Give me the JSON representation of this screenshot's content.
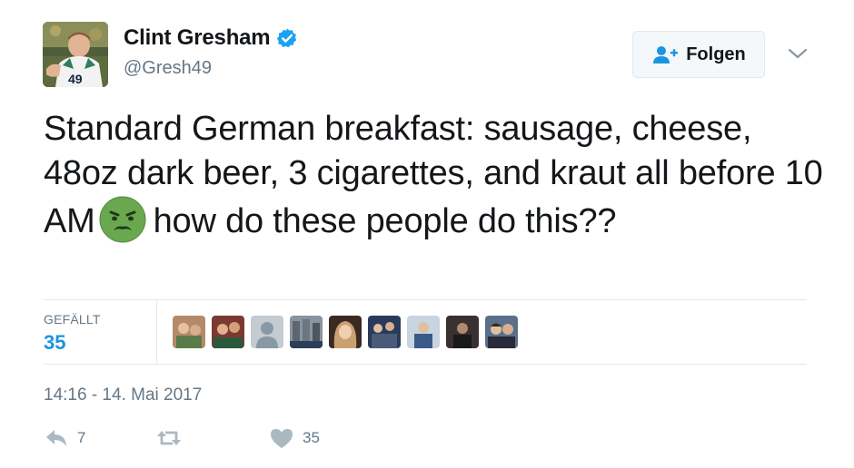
{
  "user": {
    "display_name": "Clint Gresham",
    "handle": "@Gresh49",
    "verified": true,
    "avatar_icon": "profile-photo",
    "jersey_number": "49"
  },
  "follow_button": {
    "label": "Folgen",
    "icon": "add-user-icon"
  },
  "menu": {
    "icon": "chevron-down-icon"
  },
  "tweet": {
    "text_before_emoji": "Standard German breakfast: sausage, cheese, 48oz dark beer, 3 cigarettes, and kraut all before 10 AM",
    "emoji": "nauseated-face-emoji",
    "text_after_emoji": "how do these people do this??"
  },
  "stats": {
    "likes_label": "GEFÄLLT",
    "likes_count": "35"
  },
  "likers": [
    {
      "icon": "liker-avatar",
      "color": "#b58a6a"
    },
    {
      "icon": "liker-avatar",
      "color": "#7a3a32"
    },
    {
      "icon": "default-avatar",
      "color": "#c4cbd1"
    },
    {
      "icon": "liker-avatar",
      "color": "#8a94a0"
    },
    {
      "icon": "liker-avatar",
      "color": "#c9a070"
    },
    {
      "icon": "liker-avatar",
      "color": "#4a5a78"
    },
    {
      "icon": "liker-avatar",
      "color": "#9aa8b8"
    },
    {
      "icon": "liker-avatar",
      "color": "#3a3030"
    },
    {
      "icon": "liker-avatar",
      "color": "#5a6f8a"
    }
  ],
  "timestamp": "14:16 - 14. Mai 2017",
  "actions": {
    "reply": {
      "icon": "reply-icon",
      "count": "7"
    },
    "retweet": {
      "icon": "retweet-icon",
      "count": ""
    },
    "like": {
      "icon": "heart-icon",
      "count": "35"
    }
  },
  "colors": {
    "text": "#14171a",
    "secondary": "#657786",
    "accent": "#1b95e0",
    "verified": "#1da1f2",
    "divider": "#e1e8ed"
  }
}
